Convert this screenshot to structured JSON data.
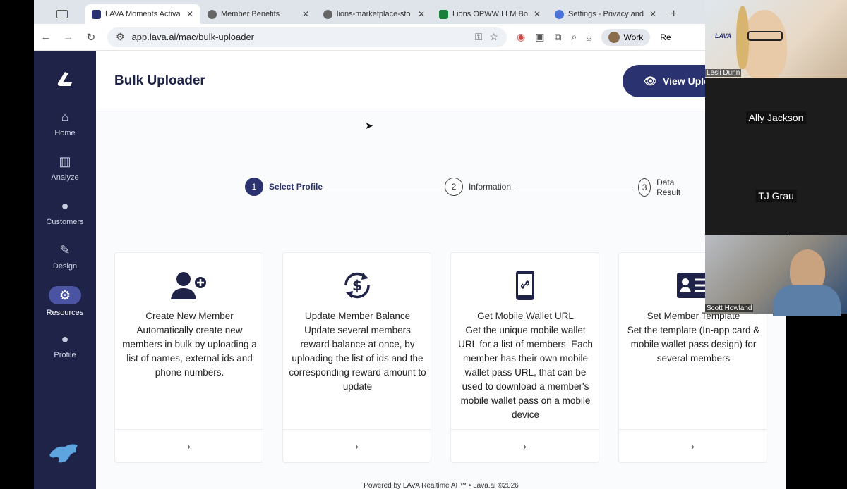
{
  "browser": {
    "tabs": [
      {
        "label": "LAVA Moments Activa",
        "icon_color": "#2b3270",
        "active": true
      },
      {
        "label": "Member Benefits",
        "icon_color": "#666666",
        "active": false
      },
      {
        "label": "lions-marketplace-sto",
        "icon_color": "#666666",
        "active": false
      },
      {
        "label": "Lions OPWW LLM Bo",
        "icon_color": "#188038",
        "active": false
      },
      {
        "label": "Settings - Privacy and",
        "icon_color": "#4a72d8",
        "active": false
      }
    ],
    "new_tab": "+",
    "url": "app.lava.ai/mac/bulk-uploader",
    "profile_label": "Work",
    "extra_label": "Re"
  },
  "sidebar": {
    "items": [
      {
        "label": "Home",
        "icon": "home-icon",
        "glyph": "⌂"
      },
      {
        "label": "Analyze",
        "icon": "bar-chart-icon",
        "glyph": "▥"
      },
      {
        "label": "Customers",
        "icon": "user-icon",
        "glyph": "●"
      },
      {
        "label": "Design",
        "icon": "edit-icon",
        "glyph": "✎"
      },
      {
        "label": "Resources",
        "icon": "gear-icon",
        "glyph": "⚙"
      },
      {
        "label": "Profile",
        "icon": "user-icon",
        "glyph": "●"
      }
    ],
    "active": "Resources"
  },
  "header": {
    "title": "Bulk Uploader",
    "view_button": "View Uploa"
  },
  "stepper": [
    {
      "num": "1",
      "label": "Select Profile",
      "active": true
    },
    {
      "num": "2",
      "label": "Information",
      "active": false
    },
    {
      "num": "3",
      "label": "Data Result",
      "active": false
    }
  ],
  "cards": [
    {
      "title": "Create New Member",
      "description": "Automatically create new members in bulk by uploading a list of names, external ids and phone numbers.",
      "icon": "add-user-icon",
      "glyph": "👤"
    },
    {
      "title": "Update Member Balance",
      "description": "Update several members reward balance at once, by uploading the list of ids and the corresponding reward amount to update",
      "icon": "dollar-sync-icon",
      "glyph": "$"
    },
    {
      "title": "Get Mobile Wallet URL",
      "description": "Get the unique mobile wallet URL for a list of members. Each member has their own mobile wallet pass URL, that can be used to download a member's mobile wallet pass on a mobile device",
      "icon": "mobile-link-icon",
      "glyph": "📱"
    },
    {
      "title": "Set Member Template",
      "description": "Set the template (In-app card & mobile wallet pass design) for several members",
      "icon": "id-card-icon",
      "glyph": "🪪"
    }
  ],
  "card_arrow": "›",
  "footer": "Powered by LAVA Realtime AI ™ • Lava.ai ©2026",
  "participants": [
    {
      "name": "Lesli Dunn",
      "style": "tag"
    },
    {
      "name": "Ally Jackson",
      "style": "center"
    },
    {
      "name": "TJ Grau",
      "style": "center"
    },
    {
      "name": "Scott Howland",
      "style": "tag"
    }
  ],
  "lava_badge": "LAVA"
}
